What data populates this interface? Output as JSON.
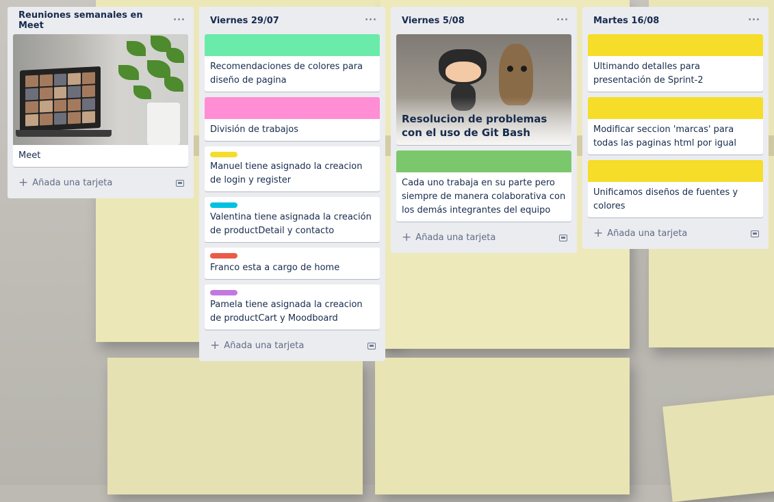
{
  "lists": [
    {
      "title": "Reuniones semanales en Meet",
      "menu": "···",
      "cards": [
        {
          "cover": "meet-laptop-photo",
          "text": "Meet"
        }
      ],
      "add_label": "Añada una tarjeta"
    },
    {
      "title": "Viernes 29/07",
      "menu": "···",
      "cards": [
        {
          "cover_color": "#6beba9",
          "text": "Recomendaciones de colores para diseño de pagina"
        },
        {
          "cover_color": "#ff8ed4",
          "text": "División de trabajos"
        },
        {
          "label_color": "#f5dd29",
          "text": "Manuel tiene asignado la creacion de login y register"
        },
        {
          "label_color": "#00c2e0",
          "text": "Valentina tiene asignada la creación de productDetail y contacto"
        },
        {
          "label_color": "#eb5a46",
          "text": "Franco esta a cargo de home"
        },
        {
          "label_color": "#c377e0",
          "text": "Pamela tiene asignada la creacion de productCart y Moodboard"
        }
      ],
      "add_label": "Añada una tarjeta"
    },
    {
      "title": "Viernes 5/08",
      "menu": "···",
      "cards": [
        {
          "cover": "github-octocat-groot-photo",
          "text": "Resolucion de problemas con el uso de Git Bash"
        },
        {
          "cover_color": "#7bc86c",
          "text": "Cada uno trabaja en su parte pero siempre de manera colaborativa con los demás integrantes del equipo"
        }
      ],
      "add_label": "Añada una tarjeta"
    },
    {
      "title": "Martes 16/08",
      "menu": "···",
      "cards": [
        {
          "cover_color": "#f5dd29",
          "text": "Ultimando detalles para presentación de Sprint-2"
        },
        {
          "cover_color": "#f5dd29",
          "text": "Modificar seccion 'marcas' para todas las paginas html por igual"
        },
        {
          "cover_color": "#f5dd29",
          "text": "Unificamos diseños de fuentes y colores"
        }
      ],
      "add_label": "Añada una tarjeta"
    }
  ],
  "icons": {
    "add": "plus-icon",
    "template": "card-template-icon",
    "menu": "more-horizontal-icon"
  }
}
